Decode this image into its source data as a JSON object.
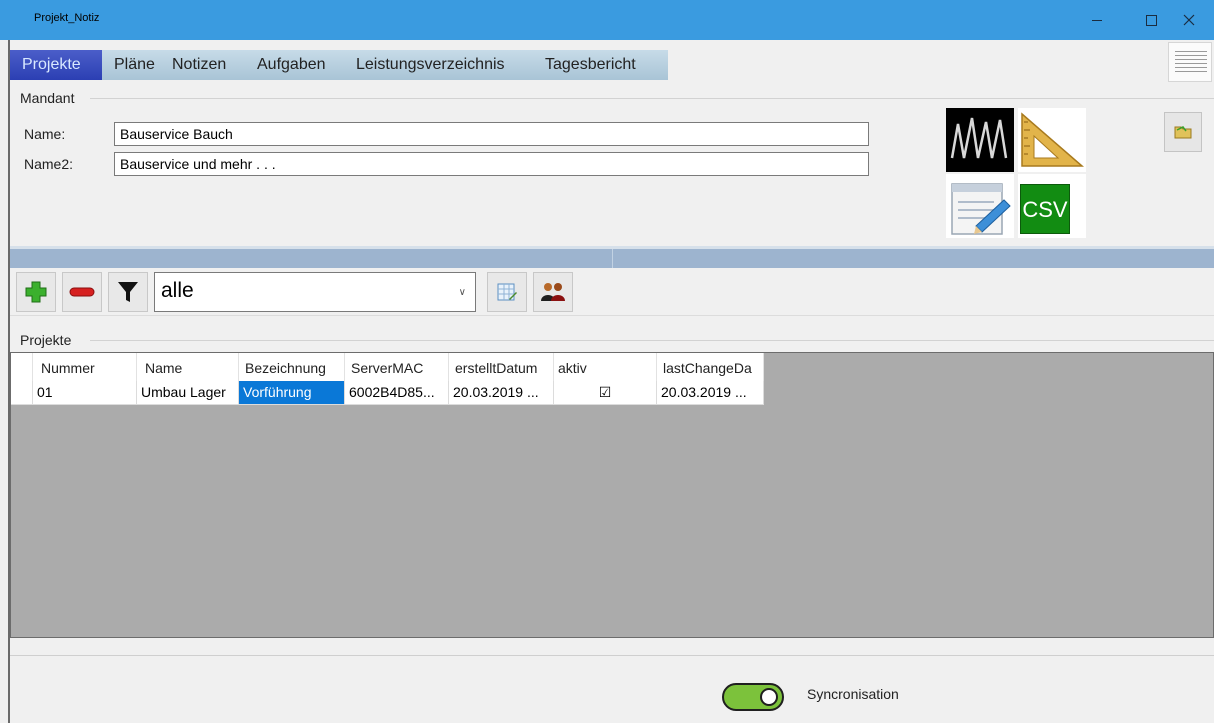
{
  "window": {
    "title": "Projekt_Notiz"
  },
  "tabs": [
    {
      "label": "Projekte",
      "active": true
    },
    {
      "label": "Pläne"
    },
    {
      "label": "Notizen"
    },
    {
      "label": "Aufgaben"
    },
    {
      "label": "Leistungsverzeichnis"
    },
    {
      "label": "Tagesbericht"
    }
  ],
  "mandant": {
    "group_title": "Mandant",
    "name_label": "Name:",
    "name_value": "Bauservice Bauch",
    "name2_label": "Name2:",
    "name2_value": "Bauservice und mehr . . ."
  },
  "tools": {
    "csv_label": "CSV",
    "icons": [
      "zigzag-chart-icon",
      "set-square-icon",
      "notepad-pencil-icon",
      "csv-export-icon"
    ]
  },
  "toolbar": {
    "filter_value": "alle",
    "icons": [
      "add-icon",
      "remove-icon",
      "filter-icon",
      "table-edit-icon",
      "users-icon"
    ]
  },
  "projects": {
    "group_title": "Projekte",
    "columns": [
      "Nummer",
      "Name",
      "Bezeichnung",
      "ServerMAC",
      "erstelltDatum",
      "aktiv",
      "lastChangeDa"
    ],
    "rows": [
      {
        "nummer": "01",
        "name": "Umbau Lager",
        "bezeichnung": "Vorführung",
        "servermac": "6002B4D85...",
        "erstelltdatum": "20.03.2019 ...",
        "aktiv_symbol": "☑",
        "lastchange": "20.03.2019 ..."
      }
    ]
  },
  "sync": {
    "label": "Syncronisation",
    "on": true
  },
  "colors": {
    "titlebar": "#3a9be0",
    "tab_active": "#2b3fb3",
    "selection": "#0a78d7",
    "toggle_on": "#7cc23b",
    "csv_bg": "#128c12",
    "grid_bg": "#ababab"
  }
}
